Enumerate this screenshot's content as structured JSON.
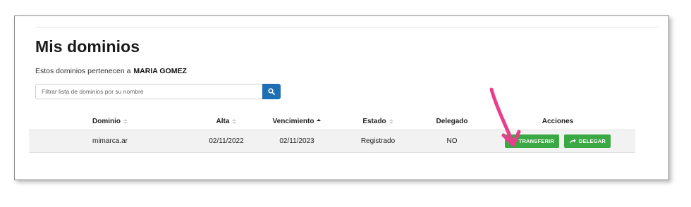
{
  "header": {
    "title": "Mis dominios",
    "owner_prefix": "Estos dominios pertenecen a",
    "owner_name": "MARIA GOMEZ"
  },
  "search": {
    "placeholder": "Filtrar lista de dominios por su nombre",
    "value": "",
    "button_icon": "search-icon"
  },
  "table": {
    "columns": [
      "Dominio",
      "Alta",
      "Vencimiento",
      "Estado",
      "Delegado",
      "Acciones"
    ],
    "sorted_column": "Vencimiento",
    "sort_direction": "ascending",
    "rows": [
      {
        "dominio": "mimarca.ar",
        "alta": "02/11/2022",
        "vencimiento": "02/11/2023",
        "estado": "Registrado",
        "delegado": "NO",
        "actions": {
          "transfer_label": "TRANSFERIR",
          "transfer_icon": "transfer-arrows-icon",
          "delegate_label": "DELEGAR",
          "delegate_icon": "share-arrow-icon"
        }
      }
    ]
  },
  "colors": {
    "accent_blue": "#1f6fb5",
    "action_green": "#3aa843",
    "annotation_pink": "#e83e8c"
  },
  "annotation": {
    "icon": "pink-pointer-arrow-icon"
  }
}
